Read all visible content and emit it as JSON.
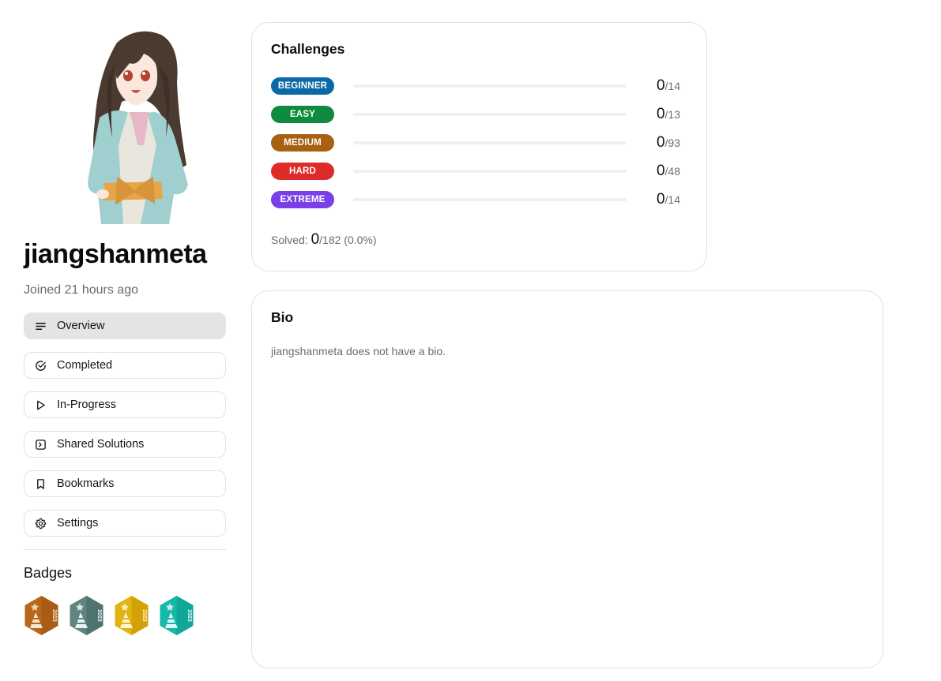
{
  "profile": {
    "username": "jiangshanmeta",
    "joined": "Joined 21 hours ago"
  },
  "nav": {
    "items": [
      {
        "label": "Overview",
        "icon": "menu-lines-icon",
        "active": true
      },
      {
        "label": "Completed",
        "icon": "check-circle-icon",
        "active": false
      },
      {
        "label": "In-Progress",
        "icon": "play-icon",
        "active": false
      },
      {
        "label": "Shared Solutions",
        "icon": "terminal-square-icon",
        "active": false
      },
      {
        "label": "Bookmarks",
        "icon": "bookmark-icon",
        "active": false
      },
      {
        "label": "Settings",
        "icon": "gear-icon",
        "active": false
      }
    ]
  },
  "badges": {
    "title": "Badges",
    "items": [
      {
        "name": "bronze-2023-badge",
        "color": "#b8661a",
        "year": "2023"
      },
      {
        "name": "silver-2023-badge",
        "color": "#5f8580",
        "year": "2023"
      },
      {
        "name": "gold-2023-badge",
        "color": "#e2b40f",
        "year": "2023"
      },
      {
        "name": "teal-2023-badge",
        "color": "#16b8a8",
        "year": "2023"
      }
    ]
  },
  "challenges": {
    "title": "Challenges",
    "difficulties": [
      {
        "label": "BEGINNER",
        "color": "#0a69a6",
        "solved": "0",
        "total": "/14"
      },
      {
        "label": "EASY",
        "color": "#0f8a3e",
        "solved": "0",
        "total": "/13"
      },
      {
        "label": "MEDIUM",
        "color": "#a86110",
        "solved": "0",
        "total": "/93"
      },
      {
        "label": "HARD",
        "color": "#df2a2a",
        "solved": "0",
        "total": "/48"
      },
      {
        "label": "EXTREME",
        "color": "#7b3fe8",
        "solved": "0",
        "total": "/14"
      }
    ],
    "solved_label": "Solved: ",
    "solved_count": "0",
    "solved_total": "/182 (0.0%)"
  },
  "bio": {
    "title": "Bio",
    "text": "jiangshanmeta does not have a bio."
  }
}
